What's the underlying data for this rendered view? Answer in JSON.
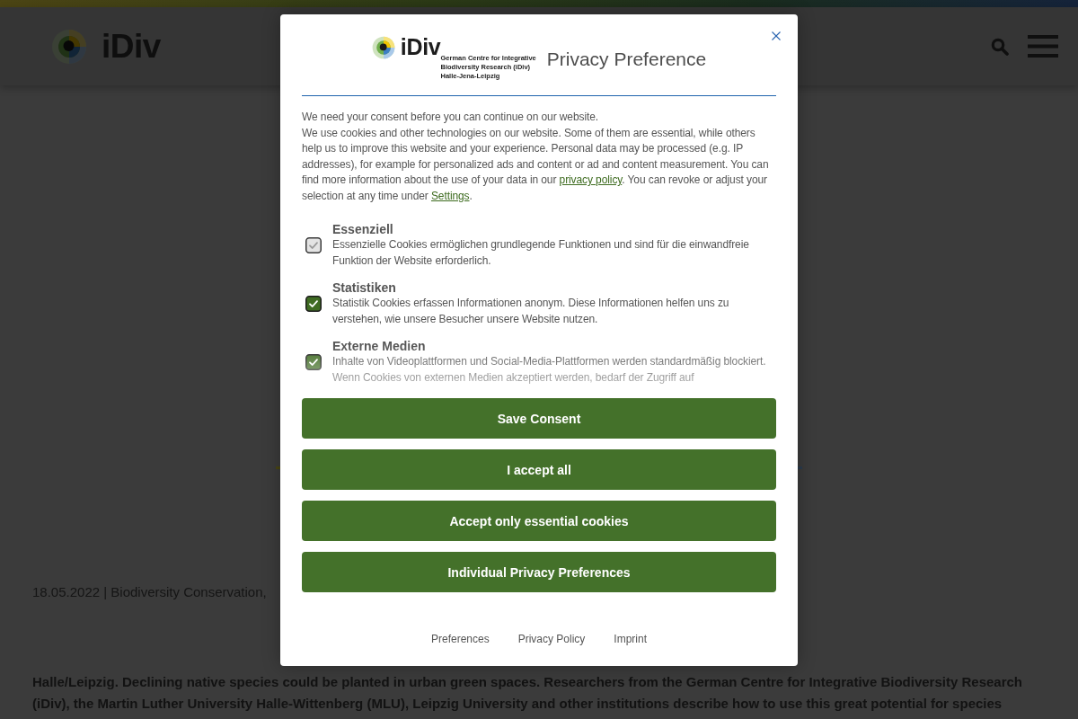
{
  "page": {
    "header": {
      "logo_text": "iDiv"
    },
    "article": {
      "meta": "18.05.2022 | Biodiversity Conservation,",
      "lead": "Halle/Leipzig. Declining native species could be planted in urban green spaces. Researchers from the German Centre for Integrative Biodiversity Research (iDiv), the Martin Luther University Halle-Wittenberg (MLU), Leipzig University and other institutions describe how to use this great potential for species"
    }
  },
  "consent_dialog": {
    "logo": {
      "name": "iDiv",
      "subtitle_lines": [
        "German Centre for Integrative",
        "Biodiversity Research (iDiv)",
        "Halle-Jena-Leipzig"
      ]
    },
    "title": "Privacy Preference",
    "intro": "We need your consent before you can continue on our website.",
    "description": [
      {
        "kind": "text",
        "text": "We use cookies and other technologies on our website. Some of them are essential, while others help us to improve this website and your experience. Personal data may be processed (e.g. IP addresses), for example for personalized ads and content or ad and content measurement. You can find more information about the use of your data in our "
      },
      {
        "kind": "link",
        "text": "privacy policy"
      },
      {
        "kind": "text",
        "text": ". You can revoke or adjust your selection at any time under "
      },
      {
        "kind": "link",
        "text": "Settings"
      },
      {
        "kind": "text",
        "text": "."
      }
    ],
    "categories": [
      {
        "title": "Essenziell",
        "description": "Essenzielle Cookies ermöglichen grundlegende Funktionen und sind für die einwandfreie Funktion der Website erforderlich.",
        "checked": true,
        "disabled": true
      },
      {
        "title": "Statistiken",
        "description": "Statistik Cookies erfassen Informationen anonym. Diese Informationen helfen uns zu verstehen, wie unsere Besucher unsere Website nutzen.",
        "checked": true,
        "disabled": false
      },
      {
        "title": "Externe Medien",
        "description": "Inhalte von Videoplattformen und Social-Media-Plattformen werden standardmäßig blockiert. Wenn Cookies von externen Medien akzeptiert werden, bedarf der Zugriff auf",
        "checked": true,
        "disabled": false
      }
    ],
    "buttons": [
      "Save Consent",
      "I accept all",
      "Accept only essential cookies",
      "Individual Privacy Preferences"
    ],
    "footer_links": [
      "Preferences",
      "Privacy Policy",
      "Imprint"
    ]
  }
}
